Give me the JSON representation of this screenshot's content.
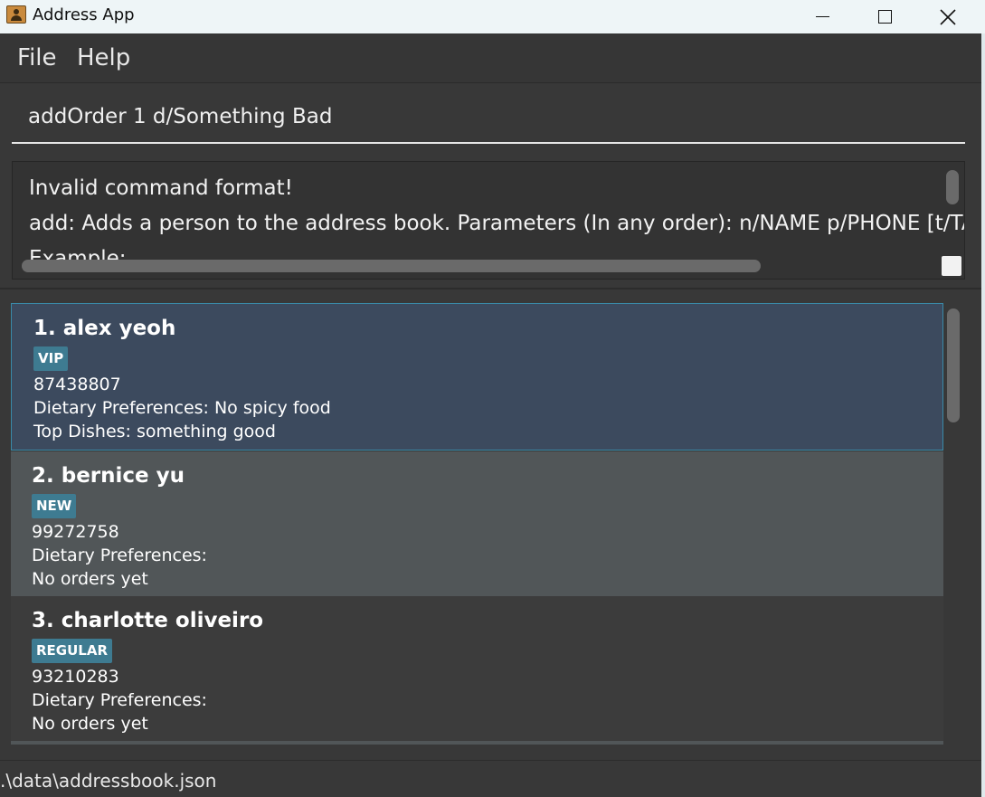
{
  "window": {
    "title": "Address App",
    "minimize_icon": "minimize-icon",
    "maximize_icon": "maximize-icon",
    "close_icon": "close-icon"
  },
  "menu": {
    "items": [
      {
        "label": "File"
      },
      {
        "label": "Help"
      }
    ]
  },
  "command": {
    "value": "addOrder 1 d/Something Bad"
  },
  "result": {
    "lines": [
      "Invalid command format!",
      "add: Adds a person to the address book. Parameters (In any order): n/NAME p/PHONE [t/TA",
      "Example:"
    ]
  },
  "persons": [
    {
      "name": "1. alex yeoh",
      "tag": "VIP",
      "phone": "87438807",
      "dietary": "Dietary Preferences: No spicy food",
      "dishes": "Top Dishes: something good"
    },
    {
      "name": "2. bernice yu",
      "tag": "NEW",
      "phone": "99272758",
      "dietary": "Dietary Preferences:",
      "dishes": "No orders yet"
    },
    {
      "name": "3. charlotte oliveiro",
      "tag": "REGULAR",
      "phone": "93210283",
      "dietary": "Dietary Preferences:",
      "dishes": "No orders yet"
    }
  ],
  "status": {
    "path": ".\\data\\addressbook.json"
  },
  "colors": {
    "selected_card": "#3c4a5e",
    "selected_border": "#3a8aa8",
    "tag": "#3e7b91",
    "background": "#383838"
  }
}
